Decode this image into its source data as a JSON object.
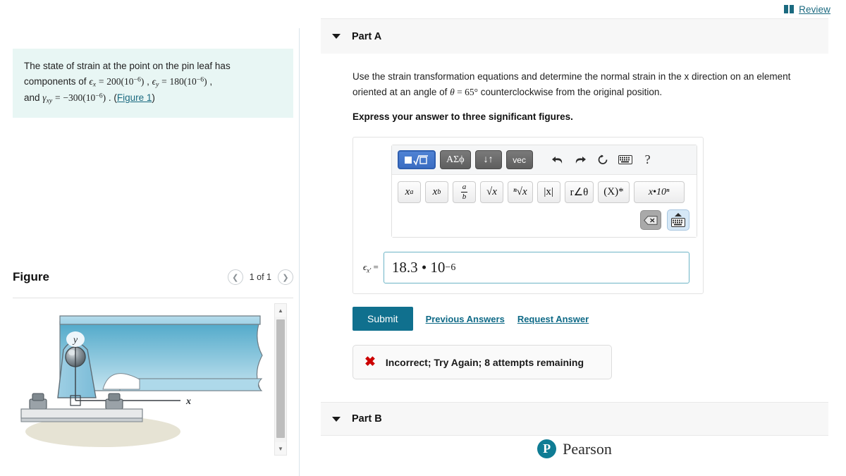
{
  "topbar": {
    "review_label": "Review",
    "review_icon": "book-icon"
  },
  "statement": {
    "line1": "The state of strain at the point on the pin leaf has",
    "line2_prefix": "components of ",
    "eps_x_sym": "ϵ",
    "eps_x_sub": "x",
    "eps_x_val": "200(10",
    "exp": "−6",
    "eps_y_sym": "ϵ",
    "eps_y_sub": "y",
    "eps_y_val": "180(10",
    "gamma_sym": "γ",
    "gamma_sub": "xy",
    "gamma_val": "−300(10",
    "and_word": "and ",
    "figure_link": "Figure 1"
  },
  "figure": {
    "title": "Figure",
    "page_indicator": "1 of 1",
    "prev_icon": "chevron-left-icon",
    "next_icon": "chevron-right-icon",
    "axis_y_label": "y",
    "axis_x_label": "x",
    "scroll_up_icon": "triangle-up-icon",
    "scroll_down_icon": "triangle-down-icon"
  },
  "partA": {
    "title": "Part A",
    "caret_icon": "caret-down-icon",
    "question_a": "Use the strain transformation equations and determine the normal strain in the x direction on an element",
    "question_b_pre": "oriented at an angle of ",
    "theta": "θ",
    "eq": " = ",
    "angle": "65°",
    "question_b_post": " counterclockwise from the original position.",
    "instruction": "Express your answer to three significant figures.",
    "answer_label_sym": "ϵ",
    "answer_label_sub": "x′",
    "answer_label_eq": "=",
    "answer_value_mantissa": "18.3 • 10",
    "answer_value_exponent": "−6",
    "submit_label": "Submit",
    "previous_answers_label": "Previous Answers",
    "request_answer_label": "Request Answer",
    "feedback_icon": "x-mark-icon",
    "feedback_text": "Incorrect; Try Again; 8 attempts remaining"
  },
  "mathbar": {
    "row1": [
      {
        "name": "template-palette-button",
        "label": "■√□",
        "active": true
      },
      {
        "name": "greek-symbols-button",
        "label": "ΑΣϕ",
        "active": false
      },
      {
        "name": "arrows-button",
        "label": "↓↑",
        "active": false
      },
      {
        "name": "vector-button",
        "label": "vec",
        "active": false
      }
    ],
    "icons": [
      {
        "name": "undo-icon",
        "glyph": "⮨"
      },
      {
        "name": "redo-icon",
        "glyph": "⮩"
      },
      {
        "name": "reset-icon",
        "glyph": "↻"
      },
      {
        "name": "keyboard-icon",
        "glyph": "⌨"
      },
      {
        "name": "help-icon",
        "glyph": "?"
      }
    ],
    "row2": [
      {
        "name": "superscript-button",
        "label": "x",
        "sup": "a"
      },
      {
        "name": "subscript-button",
        "label": "x",
        "sub": "b"
      },
      {
        "name": "fraction-button",
        "num": "a",
        "den": "b"
      },
      {
        "name": "square-root-button",
        "label": "√x"
      },
      {
        "name": "nth-root-button",
        "label": "ⁿ√x"
      },
      {
        "name": "absolute-value-button",
        "label": "|x|"
      },
      {
        "name": "polar-button",
        "label": "r∠θ"
      },
      {
        "name": "conjugate-button",
        "label": "(X)*"
      },
      {
        "name": "scientific-notation-button",
        "label": "x•10ⁿ"
      }
    ],
    "backspace_icon": "backspace-icon",
    "keyboard_toggle_icon": "keyboard-toggle-icon"
  },
  "partB": {
    "title": "Part B",
    "caret_icon": "caret-down-icon"
  },
  "footer": {
    "brand": "Pearson",
    "mark": "P"
  },
  "colors": {
    "statement_bg": "#e8f6f4",
    "link": "#1b6a80",
    "submit_bg": "#10708e",
    "error": "#cc0000",
    "input_border": "#6db4c6",
    "beam_blue": "#7fc0dc",
    "accent_active": "#3b6dc2"
  }
}
